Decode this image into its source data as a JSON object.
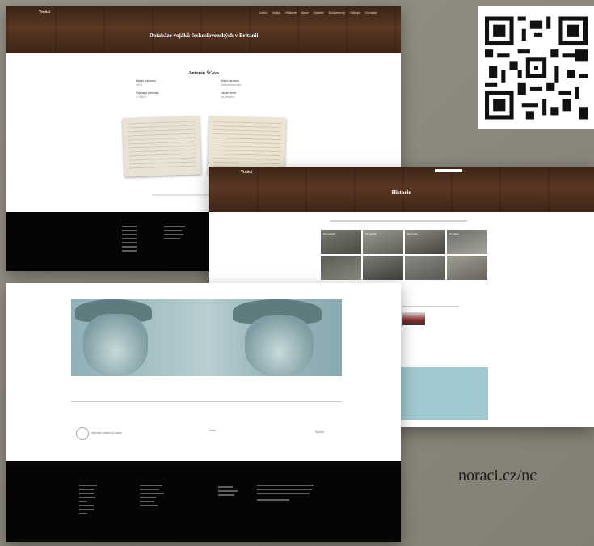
{
  "screen1": {
    "nav": {
      "logo": "Vojáci",
      "menu": [
        "Domů",
        "Vojáci",
        "Historie",
        "Akce",
        "Galerie",
        "Dokumenty",
        "Odkazy",
        "Kontakt"
      ]
    },
    "banner_title": "Databáze vojáků československých v Britanii",
    "record_title": "Antonín Šťáva",
    "fields": [
      {
        "label": "Datum narození",
        "value": "1915"
      },
      {
        "label": "Místo narození",
        "value": "Československo"
      },
      {
        "label": "Vojenská jednotka",
        "value": "1. divize"
      },
      {
        "label": "Datum úmrtí",
        "value": "neuvedeno"
      }
    ]
  },
  "screen2": {
    "nav": {
      "logo": "Vojáci"
    },
    "banner_title": "Historie",
    "thumbnails": [
      "Na cestách",
      "Ve výcviku",
      "Na frontě",
      "Po válce",
      "",
      "",
      "",
      ""
    ]
  },
  "screen3": {
    "partners": [
      "Vojenský historický ústav",
      "Ústav",
      "Spolek"
    ]
  },
  "url_text": "noraci.cz/nc"
}
